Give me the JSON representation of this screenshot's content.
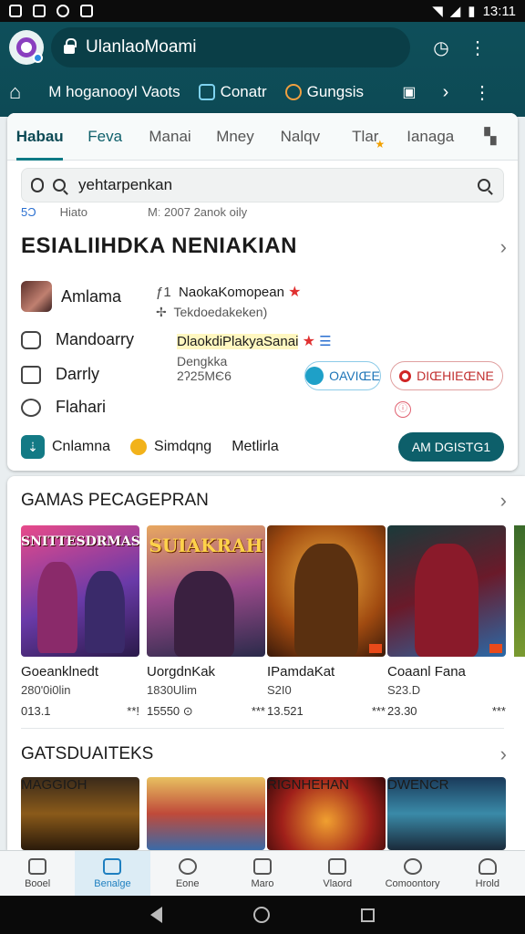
{
  "status_bar": {
    "time": "13:11"
  },
  "header": {
    "url": "UlanlaoMoami",
    "nav_links": [
      {
        "label": "M hoganooyl Vaots"
      },
      {
        "label": "Conatr"
      },
      {
        "label": "Gungsis"
      }
    ]
  },
  "tabs": [
    {
      "label": "Habau"
    },
    {
      "label": "Feva"
    },
    {
      "label": "Manai"
    },
    {
      "label": "Mney"
    },
    {
      "label": "Nalqv"
    },
    {
      "label": "Tlar"
    },
    {
      "label": "Ianaga"
    }
  ],
  "search": {
    "value": "yehtarpenkan"
  },
  "tiny_row": {
    "a": "5Ɔ",
    "b": "Hiato",
    "c": "Mː 2007 2anok oily"
  },
  "section": {
    "title": "ESIALIIHDKA NENIAKIAN",
    "rows": [
      {
        "label": "Amlama",
        "detail_title": "NaokaKomopean",
        "detail_sub": "Tekdoedakeken)"
      },
      {
        "label": "Mandoarry",
        "detail_title": "DlaokdiPlakyaSanai",
        "detail_sub": "Dengkka"
      },
      {
        "label": "Darrly",
        "detail_title": "2ʔ25MЄ6",
        "detail_sub": ""
      },
      {
        "label": "Flahari",
        "detail_title": "",
        "detail_sub": ""
      }
    ],
    "buttons": {
      "blue": "OAVIŒE",
      "red": "DIŒHIEŒNE"
    },
    "bottom": [
      {
        "label": "Cnlamna"
      },
      {
        "label": "Simdqng"
      },
      {
        "label": "Metlirla"
      }
    ],
    "add_button": "AM DGISTG1"
  },
  "games": {
    "title": "GAMAS PECAGEPRAN",
    "items": [
      {
        "art": "SNITTESDRMAS",
        "title": "Goeanklnedt",
        "sub": "280'0i0lin",
        "rating": "013.1",
        "size": "**!"
      },
      {
        "art": "SUIAKRAH",
        "title": "UorgdnKak",
        "sub": "1830Ulim",
        "rating": "15550 ⊙",
        "size": "***"
      },
      {
        "art": "",
        "title": "IPamdaKat",
        "sub": "S2I0",
        "rating": "13.521",
        "size": "***"
      },
      {
        "art": "",
        "title": "Coaanl Fana",
        "sub": "S23.D",
        "rating": "23.30",
        "size": "***"
      }
    ]
  },
  "games2": {
    "title": "GATSDUAITEKS",
    "items": [
      {
        "art": "MAGGIOH"
      },
      {
        "art": ""
      },
      {
        "art": "RIGNHEHAN"
      },
      {
        "art": "DWENCR"
      }
    ]
  },
  "bottom_nav": [
    {
      "label": "Booel"
    },
    {
      "label": "Benalge"
    },
    {
      "label": "Eone"
    },
    {
      "label": "Maro"
    },
    {
      "label": "Vlaord"
    },
    {
      "label": "Comoontory"
    },
    {
      "label": "Hrold"
    }
  ]
}
